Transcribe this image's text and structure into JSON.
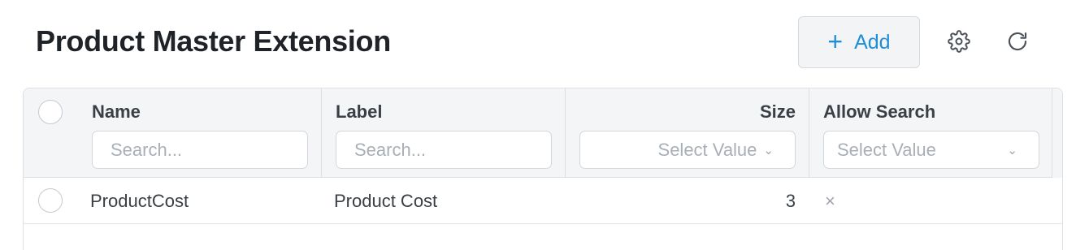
{
  "header": {
    "title": "Product Master Extension",
    "add_icon": "+",
    "add_label": "Add",
    "settings_icon": "gear-icon",
    "refresh_icon": "refresh-icon",
    "accent_color": "#1e8fd6"
  },
  "table": {
    "columns": [
      {
        "label": "Name",
        "filter_placeholder": "Search..."
      },
      {
        "label": "Label",
        "filter_placeholder": "Search..."
      },
      {
        "label": "Size",
        "filter_placeholder": "Select Value",
        "chevron": "⌄"
      },
      {
        "label": "Allow Search",
        "filter_placeholder": "Select Value",
        "chevron": "⌄"
      }
    ],
    "rows": [
      {
        "name": "ProductCost",
        "label": "Product Cost",
        "size": "3",
        "allow_search": "×"
      }
    ]
  }
}
